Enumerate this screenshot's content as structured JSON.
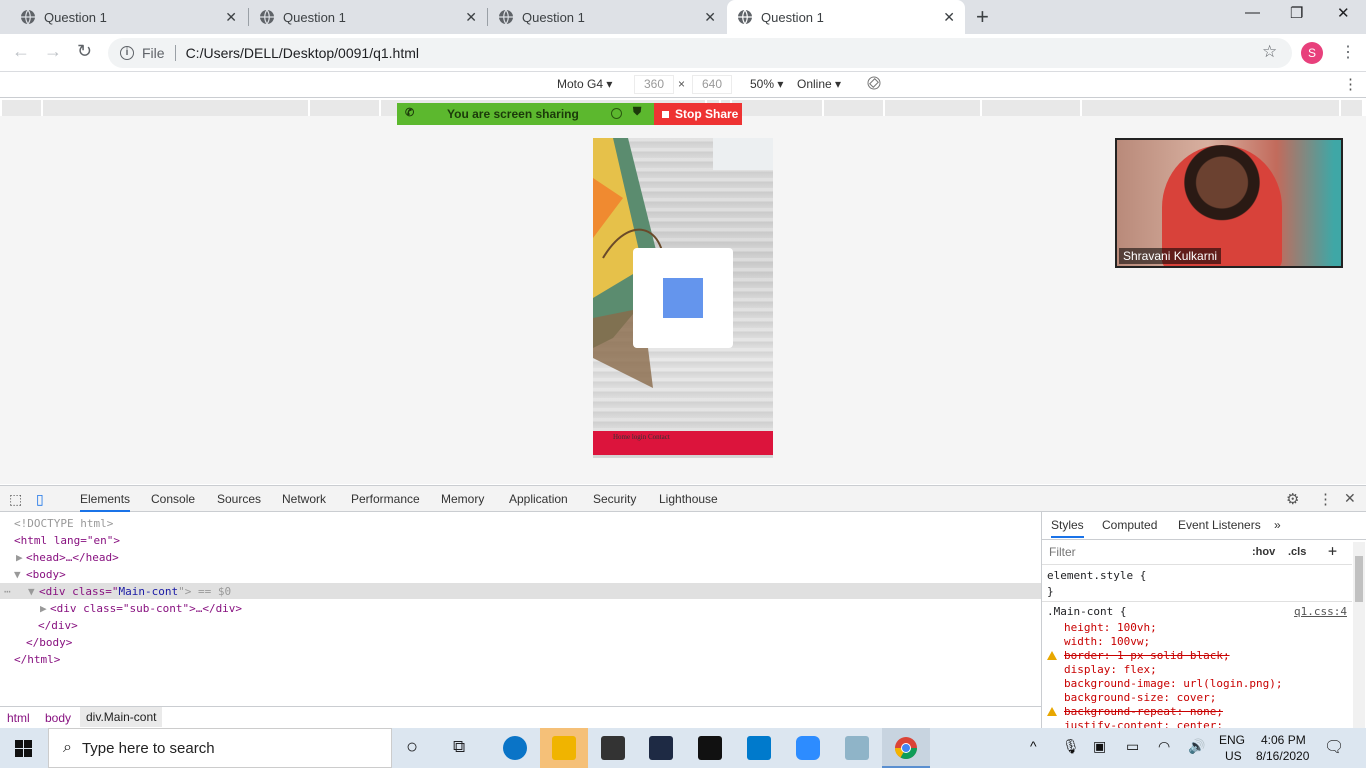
{
  "tabs": [
    {
      "title": "Question 1",
      "active": false
    },
    {
      "title": "Question 1",
      "active": false
    },
    {
      "title": "Question 1",
      "active": false
    },
    {
      "title": "Question 1",
      "active": true
    }
  ],
  "omnibox": {
    "scheme_label": "File",
    "url": "C:/Users/DELL/Desktop/0091/q1.html"
  },
  "profile_initial": "S",
  "device_toolbar": {
    "device": "Moto G4 ▾",
    "width": "360",
    "x_sep": "×",
    "height": "640",
    "zoom": "50% ▾",
    "network": "Online ▾"
  },
  "share_bar": {
    "message": "You are screen sharing",
    "stop_label": "Stop Share"
  },
  "page_preview": {
    "footer_links": "Home login Contact"
  },
  "video": {
    "participant_name": "Shravani Kulkarni"
  },
  "devtools": {
    "tabs": [
      "Elements",
      "Console",
      "Sources",
      "Network",
      "Performance",
      "Memory",
      "Application",
      "Security",
      "Lighthouse"
    ],
    "active_tab": "Elements",
    "dom": {
      "doctype": "<!DOCTYPE html>",
      "html_open": "<html lang=\"en\">",
      "head": "<head>…</head>",
      "body_open": "<body>",
      "main_div_pre": "<div class=\"",
      "main_div_class": "Main-cont",
      "main_div_post": "\"> == $0",
      "sub_div": "<div class=\"sub-cont\">…</div>",
      "div_close": "</div>",
      "body_close": "</body>",
      "html_close": "</html>"
    },
    "breadcrumbs": [
      "html",
      "body",
      "div.Main-cont"
    ],
    "styles_tabs": [
      "Styles",
      "Computed",
      "Event Listeners"
    ],
    "filter_placeholder": "Filter",
    "hov": ":hov",
    "cls": ".cls",
    "element_style_open": "element.style {",
    "element_style_close": "}",
    "rule_selector": ".Main-cont {",
    "rule_source": "q1.css:4",
    "declarations": [
      {
        "text": "height: 100vh;",
        "struck": false,
        "warn": false
      },
      {
        "text": "width: 100vw;",
        "struck": false,
        "warn": false
      },
      {
        "text": "border: 1 px solid black;",
        "struck": true,
        "warn": true
      },
      {
        "text": "display: flex;",
        "struck": false,
        "warn": false
      },
      {
        "text": "background-image: url(login.png);",
        "struck": false,
        "warn": false
      },
      {
        "text": "background-size: cover;",
        "struck": false,
        "warn": false
      },
      {
        "text": "background-repeat: none;",
        "struck": true,
        "warn": true
      },
      {
        "text": "justify-content: center;",
        "struck": false,
        "warn": false
      }
    ]
  },
  "taskbar": {
    "search_placeholder": "Type here to search",
    "lang1": "ENG",
    "lang2": "US",
    "time": "4:06 PM",
    "date": "8/16/2020"
  }
}
